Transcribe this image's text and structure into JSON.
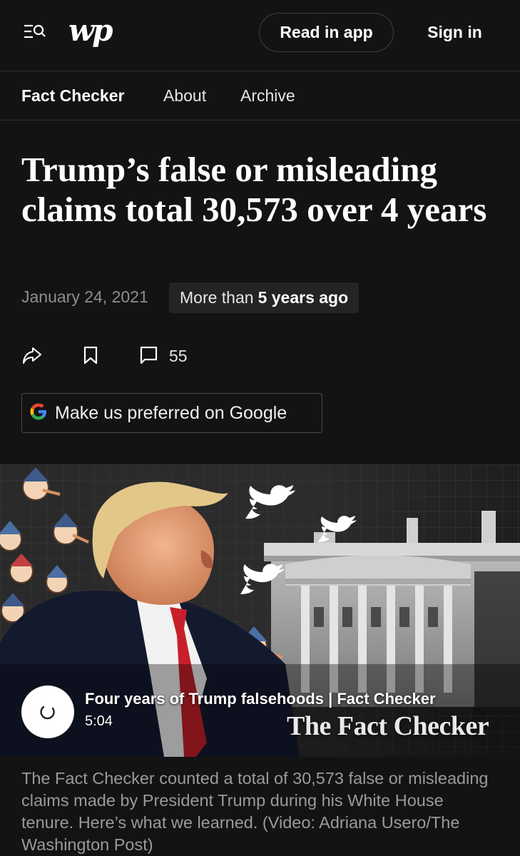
{
  "header": {
    "logo_text": "wp",
    "read_in_app_label": "Read in app",
    "sign_in_label": "Sign in"
  },
  "nav": {
    "items": [
      {
        "label": "Fact Checker"
      },
      {
        "label": "About"
      },
      {
        "label": "Archive"
      }
    ]
  },
  "article": {
    "headline": "Trump’s false or misleading claims total 30,573 over 4 years",
    "date": "January 24, 2021",
    "age_prefix": "More than",
    "age_bold": "5 years ago",
    "comment_count": "55",
    "google_label": "Make us preferred on Google"
  },
  "video": {
    "title": "Four years of Trump falsehoods | Fact Checker",
    "duration": "5:04",
    "watermark": "The Fact Checker"
  },
  "caption": "The Fact Checker counted a total of 30,573 false or misleading claims made by President Trump during his White House tenure. Here’s what we learned. (Video: Adriana Usero/The Washington Post)",
  "icons": [
    "menu-search-icon",
    "share-icon",
    "bookmark-icon",
    "comment-icon",
    "google-g-icon",
    "loading-spinner-icon",
    "twitter-bird-icon"
  ]
}
